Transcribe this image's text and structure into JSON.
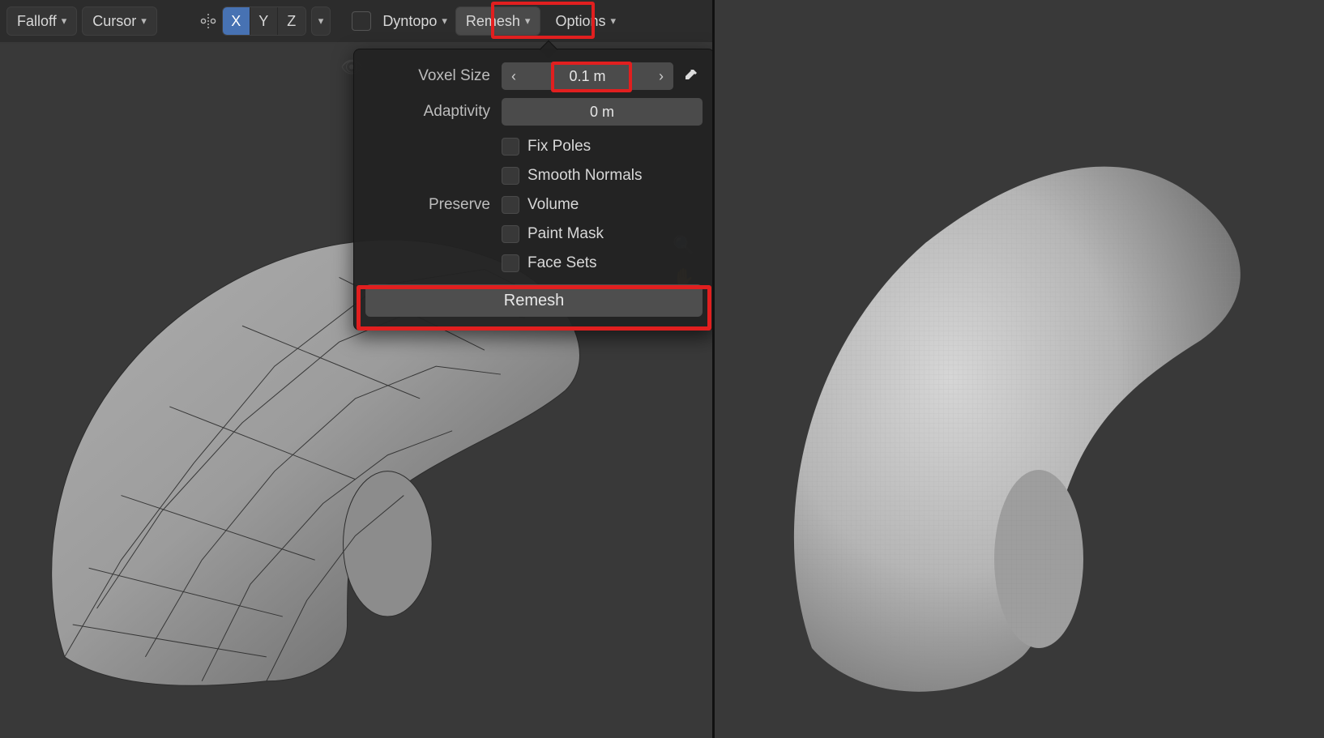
{
  "header": {
    "falloff_label": "Falloff",
    "cursor_label": "Cursor",
    "axis": {
      "x": "X",
      "y": "Y",
      "z": "Z",
      "active": "X"
    },
    "dyntopo_label": "Dyntopo",
    "remesh_label": "Remesh",
    "options_label": "Options"
  },
  "popover": {
    "voxel_size_label": "Voxel Size",
    "voxel_size_value": "0.1 m",
    "adaptivity_label": "Adaptivity",
    "adaptivity_value": "0 m",
    "fix_poles_label": "Fix Poles",
    "smooth_normals_label": "Smooth Normals",
    "preserve_label": "Preserve",
    "preserve_volume_label": "Volume",
    "preserve_paint_mask_label": "Paint Mask",
    "preserve_face_sets_label": "Face Sets",
    "remesh_button_label": "Remesh"
  },
  "highlights": {
    "remesh_header": true,
    "voxel_value": true,
    "remesh_button": true
  }
}
